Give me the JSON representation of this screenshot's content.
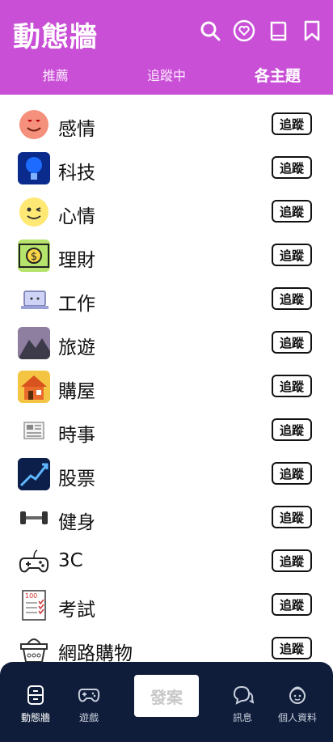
{
  "header": {
    "title": "動態牆",
    "icons": [
      "search-icon",
      "heart-bubble-icon",
      "book-icon",
      "bookmark-icon"
    ]
  },
  "tabs": [
    {
      "label": "推薦"
    },
    {
      "label": "追蹤中"
    },
    {
      "label": "各主題"
    }
  ],
  "topics": [
    {
      "label": "感情",
      "follow": "追蹤",
      "icon": "love-emoji-icon"
    },
    {
      "label": "科技",
      "follow": "追蹤",
      "icon": "tech-brain-icon"
    },
    {
      "label": "心情",
      "follow": "追蹤",
      "icon": "wink-emoji-icon"
    },
    {
      "label": "理財",
      "follow": "追蹤",
      "icon": "money-icon"
    },
    {
      "label": "工作",
      "follow": "追蹤",
      "icon": "laptop-icon"
    },
    {
      "label": "旅遊",
      "follow": "追蹤",
      "icon": "mountain-icon"
    },
    {
      "label": "購屋",
      "follow": "追蹤",
      "icon": "house-icon"
    },
    {
      "label": "時事",
      "follow": "追蹤",
      "icon": "newspaper-icon"
    },
    {
      "label": "股票",
      "follow": "追蹤",
      "icon": "stock-chart-icon"
    },
    {
      "label": "健身",
      "follow": "追蹤",
      "icon": "dumbbell-icon"
    },
    {
      "label": "3C",
      "follow": "追蹤",
      "icon": "gamepad-icon"
    },
    {
      "label": "考試",
      "follow": "追蹤",
      "icon": "exam-paper-icon"
    },
    {
      "label": "網路購物",
      "follow": "追蹤",
      "icon": "basket-icon"
    }
  ],
  "bottom_nav": {
    "wall": "動態牆",
    "games": "遊戲",
    "post": "發案",
    "messages": "訊息",
    "profile": "個人資料"
  },
  "colors": {
    "header_bg": "#c94fd6",
    "bottom_bg": "#0f1d3b"
  }
}
